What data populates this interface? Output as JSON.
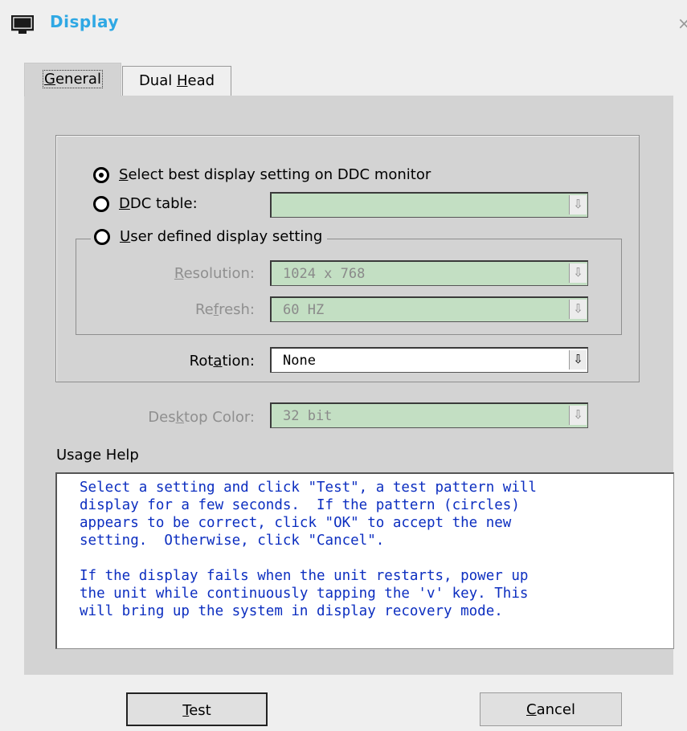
{
  "window": {
    "title": "Display",
    "close_glyph": "×",
    "icon": "monitor-icon"
  },
  "tabs": [
    {
      "pre": "",
      "u": "G",
      "post": "eneral",
      "active": true
    },
    {
      "pre": "Dual ",
      "u": "H",
      "post": "ead",
      "active": false
    }
  ],
  "options": {
    "best": {
      "pre": "",
      "u": "S",
      "post": "elect best display setting on DDC monitor",
      "checked": true
    },
    "ddc": {
      "pre": "",
      "u": "D",
      "post": "DC table:",
      "checked": false,
      "value": ""
    },
    "user": {
      "pre": "",
      "u": "U",
      "post": "ser defined display setting",
      "checked": false
    }
  },
  "fields": {
    "resolution": {
      "pre": "",
      "u": "R",
      "post": "esolution:",
      "value": "1024 x 768"
    },
    "refresh": {
      "pre": "Re",
      "u": "f",
      "post": "resh:",
      "value": "60 HZ"
    },
    "rotation": {
      "pre": "Rot",
      "u": "a",
      "post": "tion:",
      "value": "None"
    },
    "desktop_color": {
      "pre": "Des",
      "u": "k",
      "post": "top Color:",
      "value": "32 bit"
    }
  },
  "dropdown_arrow": "⇩",
  "usage": {
    "label": "Usage Help",
    "text": "Select a setting and click \"Test\", a test pattern will\ndisplay for a few seconds.  If the pattern (circles)\nappears to be correct, click \"OK\" to accept the new\nsetting.  Otherwise, click \"Cancel\".\n\nIf the display fails when the unit restarts, power up\nthe unit while continuously tapping the 'v' key. This\nwill bring up the system in display recovery mode."
  },
  "buttons": {
    "test": {
      "pre": "",
      "u": "T",
      "post": "est"
    },
    "cancel": {
      "pre": "",
      "u": "C",
      "post": "ancel"
    }
  }
}
